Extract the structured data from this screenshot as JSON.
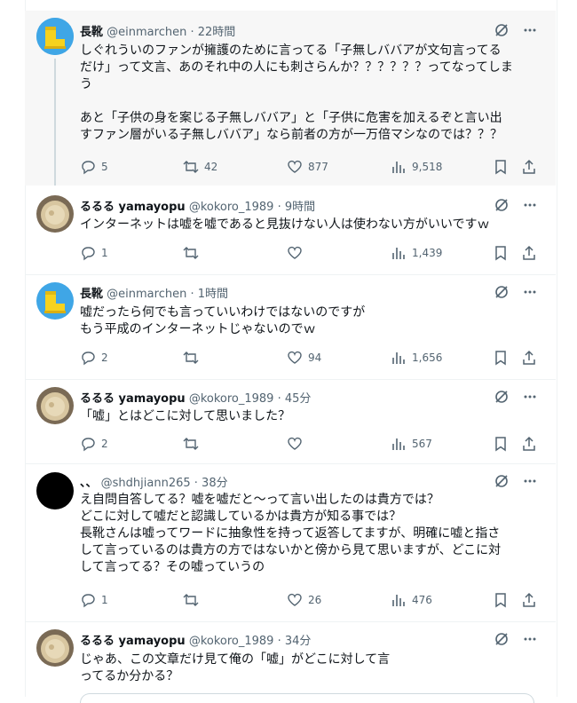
{
  "tweets": [
    {
      "name": "長靴",
      "handle": "@einmarchen",
      "time": "· 22時間",
      "lines": [
        "しぐれういのファンが擁護のために言ってる「子無しババアが文句言ってる",
        "だけ」って文言、あのそれ中の人にも刺さらんか？？？？？？ってなってしま",
        "う",
        "",
        "あと「子供の身を案じる子無しババア」と「子供に危害を加えるぞと言い出",
        "すファン層がいる子無しババア」なら前者の方が一万倍マシなのでは？？？"
      ],
      "replies": "5",
      "retweets": "42",
      "likes": "877",
      "views": "9,518"
    },
    {
      "name": "るるる yamayopu",
      "handle": "@kokoro_1989",
      "time": "· 9時間",
      "lines": [
        "インターネットは嘘を嘘であると見抜けない人は使わない方がいいですｗ"
      ],
      "replies": "1",
      "retweets": "",
      "likes": "",
      "views": "1,439"
    },
    {
      "name": "長靴",
      "handle": "@einmarchen",
      "time": "· 1時間",
      "lines": [
        "嘘だったら何でも言っていいわけではないのですが",
        "もう平成のインターネットじゃないのでｗ"
      ],
      "replies": "2",
      "retweets": "",
      "likes": "94",
      "views": "1,656"
    },
    {
      "name": "るるる yamayopu",
      "handle": "@kokoro_1989",
      "time": "· 45分",
      "lines": [
        "「嘘」とはどこに対して思いました？"
      ],
      "replies": "2",
      "retweets": "",
      "likes": "",
      "views": "567"
    },
    {
      "name": "、、",
      "handle": "@shdhjiann265",
      "time": "· 38分",
      "lines": [
        "え自問自答してる？嘘を嘘だと〜って言い出したのは貴方では？",
        "どこに対して嘘だと認識しているかは貴方が知る事では？",
        "長靴さんは嘘ってワードに抽象性を持って返答してますが、明確に嘘と指さ",
        "して言っているのは貴方の方ではないかと傍から見て思いますが、どこに対",
        "して言ってる？その嘘っていうの"
      ],
      "replies": "1",
      "retweets": "",
      "likes": "26",
      "views": "476"
    },
    {
      "name": "るるる yamayopu",
      "handle": "@kokoro_1989",
      "time": "· 34分",
      "lines": [
        "じゃあ、この文章だけ見て俺の「嘘」がどこに対して言",
        "ってるか分かる？"
      ],
      "replies": "",
      "retweets": "",
      "likes": "",
      "views": ""
    }
  ]
}
